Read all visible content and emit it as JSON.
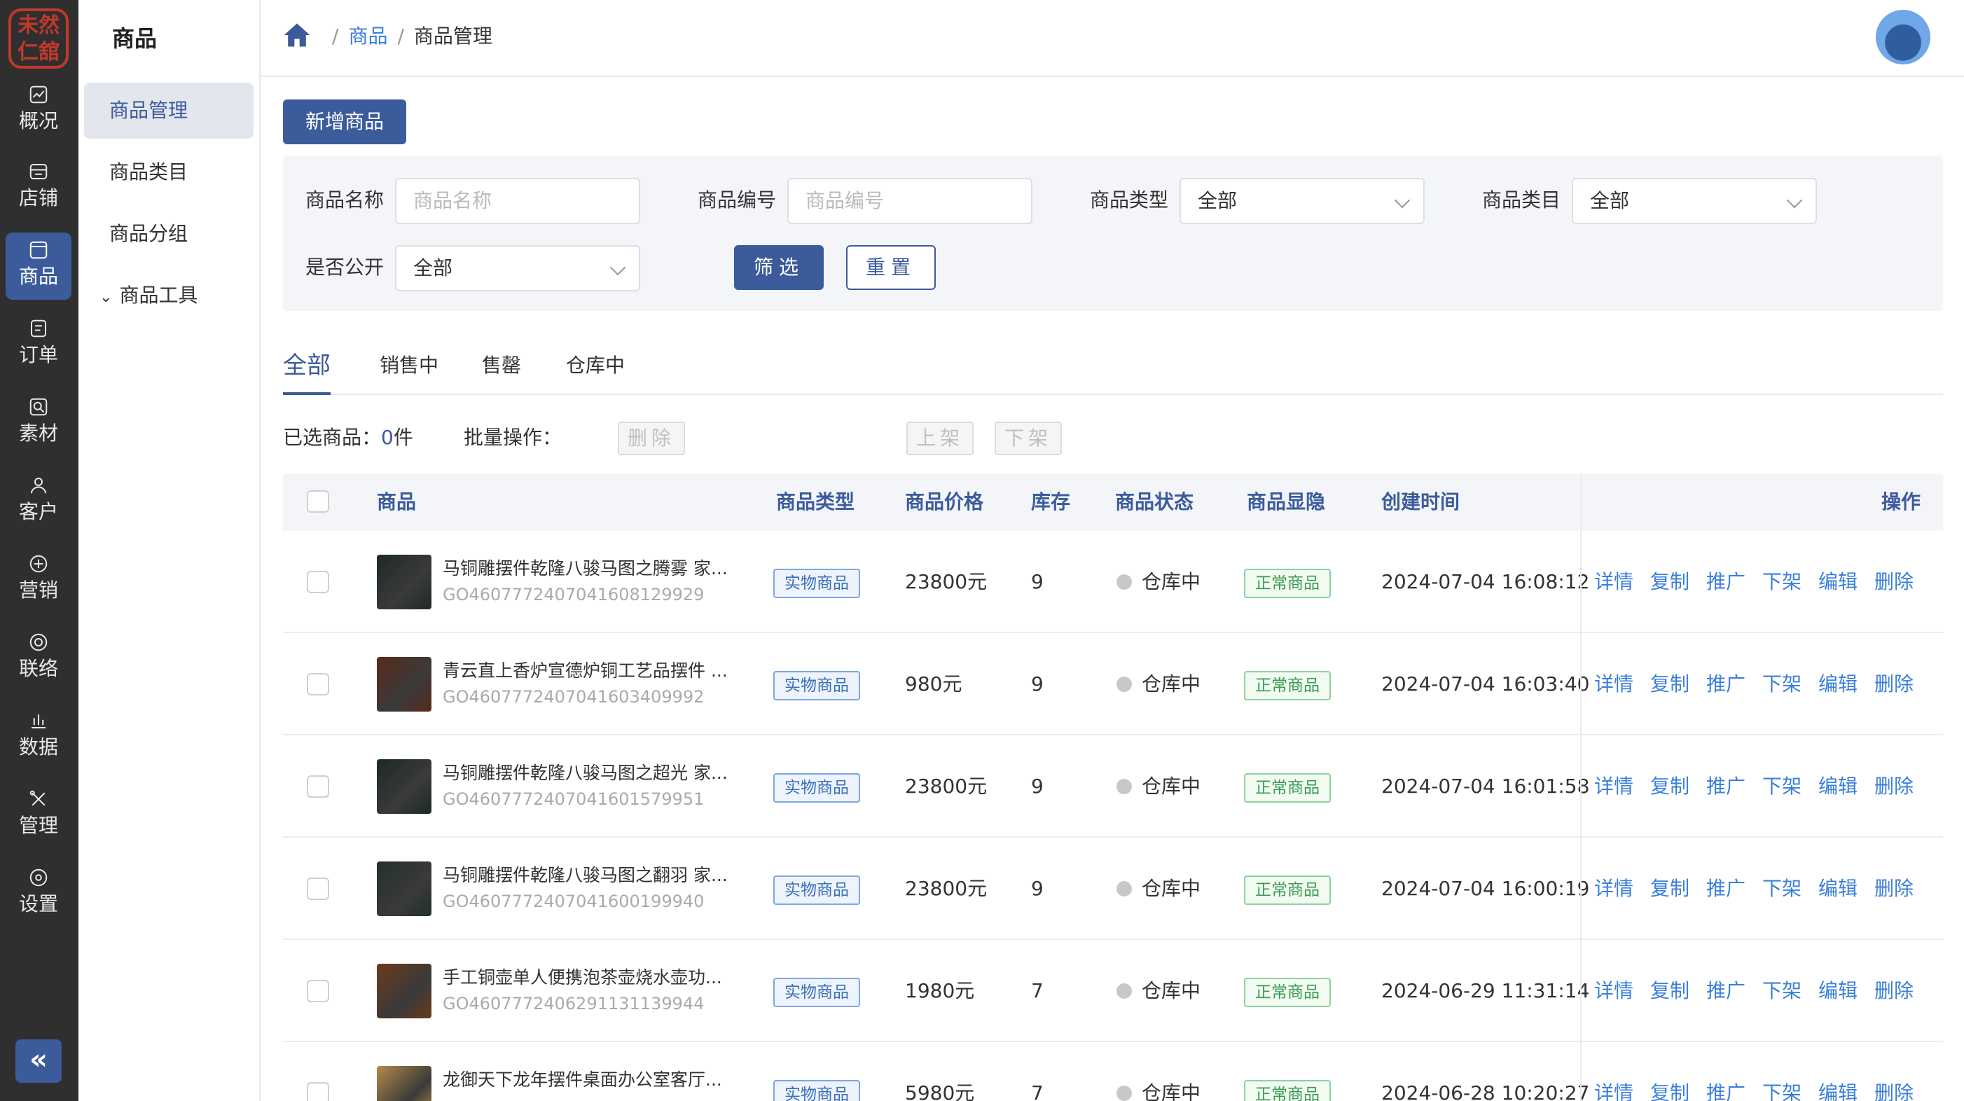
{
  "logo": {
    "text": "未然仁舘"
  },
  "rail": {
    "items": [
      {
        "label": "概况",
        "icon": "chart-icon"
      },
      {
        "label": "店铺",
        "icon": "store-icon"
      },
      {
        "label": "商品",
        "icon": "goods-icon",
        "active": true
      },
      {
        "label": "订单",
        "icon": "order-icon"
      },
      {
        "label": "素材",
        "icon": "media-icon"
      },
      {
        "label": "客户",
        "icon": "user-icon"
      },
      {
        "label": "营销",
        "icon": "marketing-icon"
      },
      {
        "label": "联络",
        "icon": "connect-icon"
      },
      {
        "label": "数据",
        "icon": "bar-chart-icon"
      },
      {
        "label": "管理",
        "icon": "tools-icon"
      },
      {
        "label": "设置",
        "icon": "settings-icon"
      }
    ],
    "collapse": "«"
  },
  "subnav": {
    "title": "商品",
    "items": [
      {
        "label": "商品管理",
        "active": true
      },
      {
        "label": "商品类目"
      },
      {
        "label": "商品分组"
      },
      {
        "label": "商品工具",
        "chevron": "⌄"
      }
    ]
  },
  "header": {
    "breadcrumb": {
      "sep": "/",
      "level1": "商品",
      "level2": "商品管理"
    }
  },
  "main": {
    "add_button": "新增商品",
    "filter": {
      "name_label": "商品名称",
      "name_placeholder": "商品名称",
      "code_label": "商品编号",
      "code_placeholder": "商品编号",
      "type_label": "商品类型",
      "type_value": "全部",
      "category_label": "商品类目",
      "category_value": "全部",
      "public_label": "是否公开",
      "public_value": "全部",
      "filter_button": "筛选",
      "reset_button": "重置"
    },
    "tabs": [
      "全部",
      "销售中",
      "售罄",
      "仓库中"
    ],
    "bulk": {
      "selected_label": "已选商品：",
      "selected_count": "0",
      "unit": "件",
      "ops_label": "批量操作：",
      "delete": "删除",
      "on_shelf": "上架",
      "off_shelf": "下架"
    },
    "table": {
      "headers": [
        "商品",
        "商品类型",
        "商品价格",
        "库存",
        "商品状态",
        "商品显隐",
        "创建时间",
        "操作"
      ],
      "actions": [
        "详情",
        "复制",
        "推广",
        "下架",
        "编辑",
        "删除"
      ],
      "rows": [
        {
          "name": "马铜雕摆件乾隆八骏马图之腾雾 家...",
          "code": "GO460777240704160812992​9",
          "type": "实物商品",
          "price": "23800元",
          "stock": "9",
          "status": "仓库中",
          "visibility": "正常商品",
          "created": "2024-07-04 16:08:12",
          "thumb": "#1f2a26"
        },
        {
          "name": "青云直上香炉宣德炉铜工艺品摆件 ...",
          "code": "GO4607772407041603409992",
          "type": "实物商品",
          "price": "980元",
          "stock": "9",
          "status": "仓库中",
          "visibility": "正常商品",
          "created": "2024-07-04 16:03:40",
          "thumb": "#5a2a1a"
        },
        {
          "name": "马铜雕摆件乾隆八骏马图之超光 家...",
          "code": "GO4607772407041601579951",
          "type": "实物商品",
          "price": "23800元",
          "stock": "9",
          "status": "仓库中",
          "visibility": "正常商品",
          "created": "2024-07-04 16:01:58",
          "thumb": "#1d2a22"
        },
        {
          "name": "马铜雕摆件乾隆八骏马图之翻羽 家...",
          "code": "GO4607772407041600199940",
          "type": "实物商品",
          "price": "23800元",
          "stock": "9",
          "status": "仓库中",
          "visibility": "正常商品",
          "created": "2024-07-04 16:00:19",
          "thumb": "#23302a"
        },
        {
          "name": "手工铜壶单人便携泡茶壶烧水壶功...",
          "code": "GO4607772406291131139944",
          "type": "实物商品",
          "price": "1980元",
          "stock": "7",
          "status": "仓库中",
          "visibility": "正常商品",
          "created": "2024-06-29 11:31:14",
          "thumb": "#6b3a1c"
        },
        {
          "name": "龙御天下龙年摆件桌面办公室客厅...",
          "code": "",
          "type": "实物商品",
          "price": "5980元",
          "stock": "7",
          "status": "仓库中",
          "visibility": "正常商品",
          "created": "2024-06-28 10:20:27",
          "thumb": "#b48a4a"
        }
      ]
    }
  }
}
